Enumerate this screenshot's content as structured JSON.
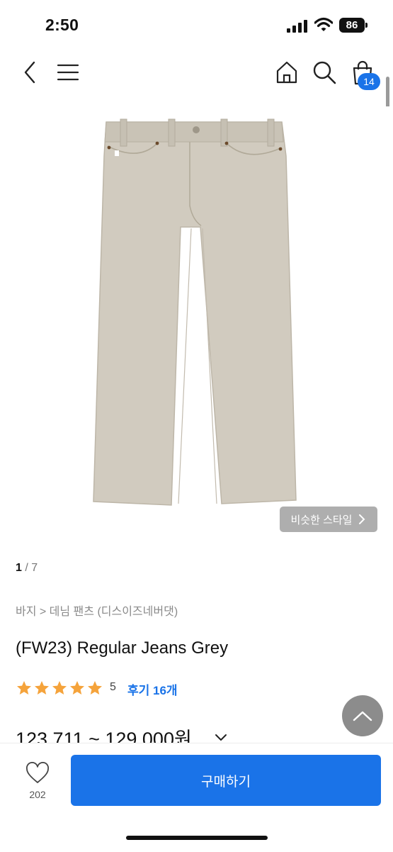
{
  "status_bar": {
    "time": "2:50",
    "battery": "86"
  },
  "nav": {
    "cart_count": "14"
  },
  "gallery": {
    "similar_style_label": "비슷한 스타일",
    "current": "1",
    "separator": " / ",
    "total": "7"
  },
  "product": {
    "breadcrumb": "바지 > 데님 팬츠 (디스이즈네버댓)",
    "title": "(FW23) Regular Jeans Grey",
    "rating": "5",
    "reviews_label": "후기 16개",
    "price": "123,711 ~ 129,000원"
  },
  "bottom_bar": {
    "like_count": "202",
    "buy_label": "구매하기"
  },
  "colors": {
    "accent": "#1a73e8",
    "star": "#f5a33b",
    "jeans": "#d1cbbf"
  }
}
